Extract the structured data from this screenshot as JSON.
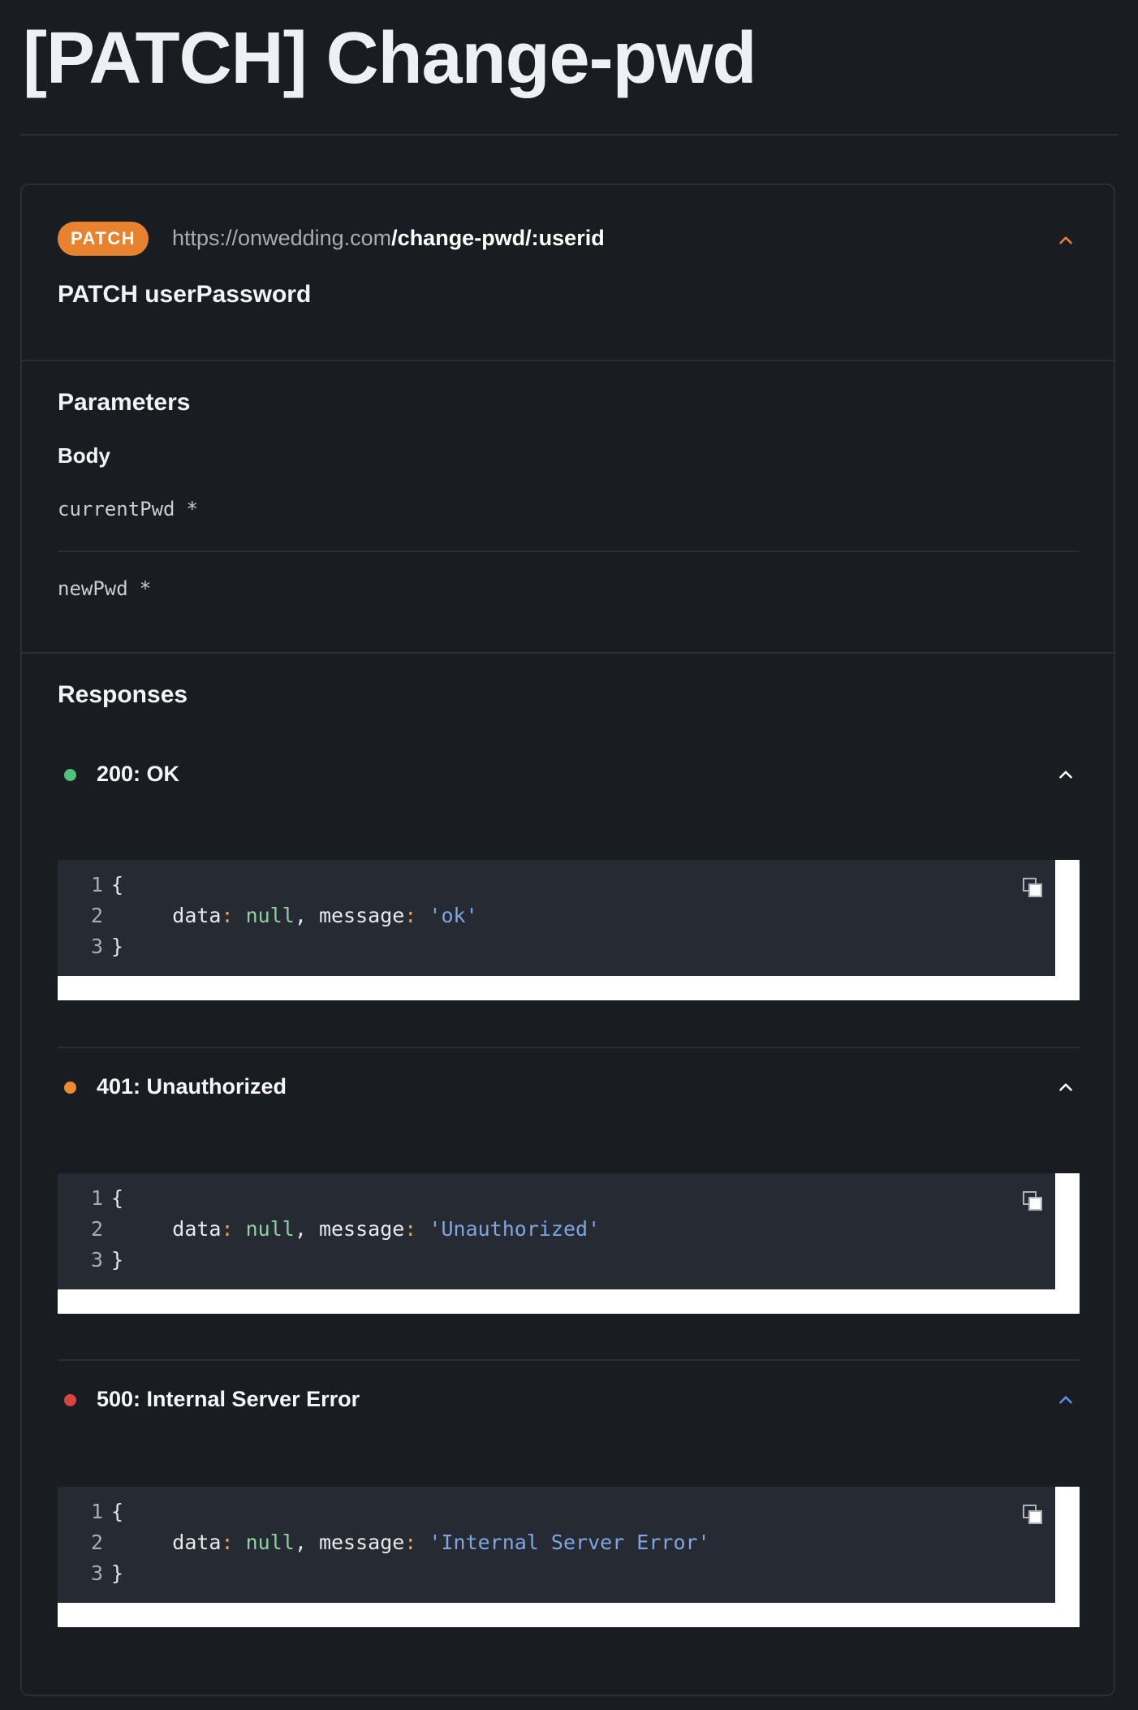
{
  "page": {
    "title": "[PATCH] Change-pwd"
  },
  "endpoint": {
    "method": "PATCH",
    "base_url": "https://onwedding.com",
    "path": "/change-pwd/:userid",
    "name": "PATCH userPassword",
    "collapse_icon": "chevron-up-icon",
    "accent_color": "#e8822f"
  },
  "parameters": {
    "heading": "Parameters",
    "body_label": "Body",
    "fields": [
      {
        "name": "currentPwd",
        "required_marker": "*"
      },
      {
        "name": "newPwd",
        "required_marker": "*"
      }
    ]
  },
  "responses": {
    "heading": "Responses",
    "items": [
      {
        "status": "200: OK",
        "dot_color": "#4cc27a",
        "chevron_color": "#ffffff",
        "code": {
          "line_numbers": [
            "1",
            "2",
            "3"
          ],
          "open": "{",
          "key1": "data",
          "null": "null",
          "key2": "message",
          "string": "'ok'",
          "close": "}"
        }
      },
      {
        "status": "401: Unauthorized",
        "dot_color": "#ef8a2c",
        "chevron_color": "#ffffff",
        "code": {
          "line_numbers": [
            "1",
            "2",
            "3"
          ],
          "open": "{",
          "key1": "data",
          "null": "null",
          "key2": "message",
          "string": "'Unauthorized'",
          "close": "}"
        }
      },
      {
        "status": "500: Internal Server Error",
        "dot_color": "#d9443c",
        "chevron_color": "#5b8fe8",
        "code": {
          "line_numbers": [
            "1",
            "2",
            "3"
          ],
          "open": "{",
          "key1": "data",
          "null": "null",
          "key2": "message",
          "string": "'Internal Server Error'",
          "close": "}"
        }
      }
    ],
    "copy_icon": "copy-icon"
  }
}
